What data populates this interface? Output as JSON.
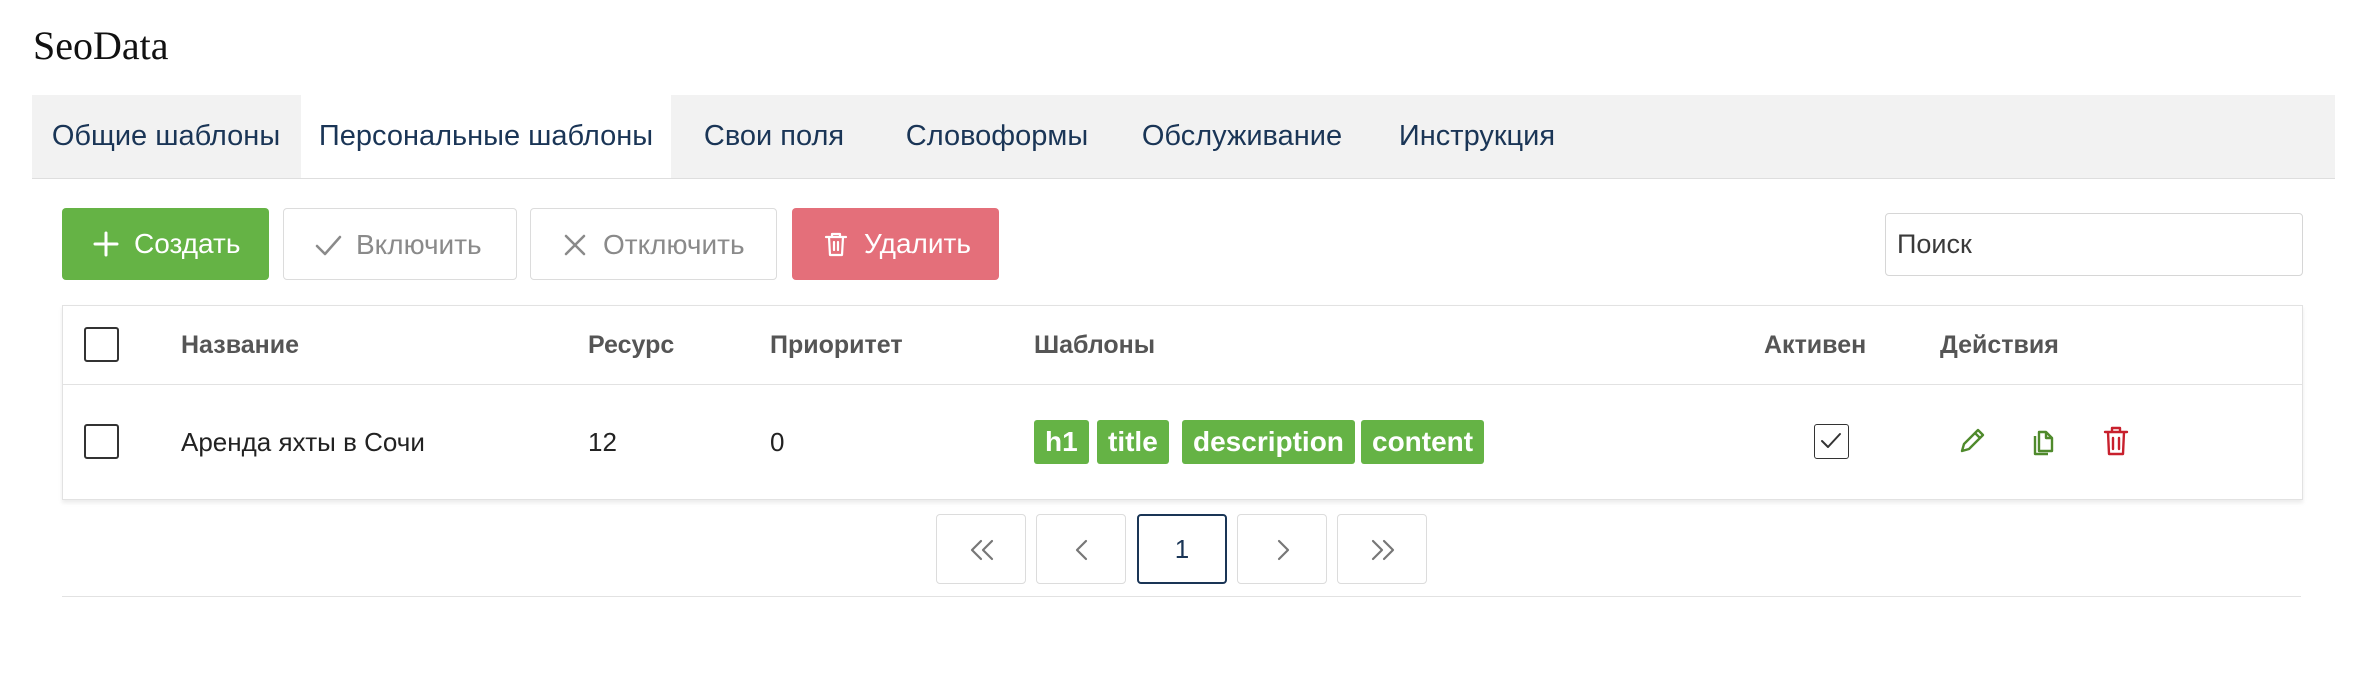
{
  "app": {
    "title": "SeoData"
  },
  "tabs": [
    {
      "label": "Общие шаблоны",
      "active": false
    },
    {
      "label": "Персональные шаблоны",
      "active": true
    },
    {
      "label": "Свои поля",
      "active": false
    },
    {
      "label": "Словоформы",
      "active": false
    },
    {
      "label": "Обслуживание",
      "active": false
    },
    {
      "label": "Инструкция",
      "active": false
    }
  ],
  "toolbar": {
    "create_label": "Создать",
    "enable_label": "Включить",
    "disable_label": "Отключить",
    "delete_label": "Удалить"
  },
  "search": {
    "placeholder": "Поиск",
    "value": ""
  },
  "table": {
    "columns": [
      "Название",
      "Ресурс",
      "Приоритет",
      "Шаблоны",
      "Активен",
      "Действия"
    ],
    "rows": [
      {
        "name": "Аренда яхты в Сочи",
        "resource": "12",
        "priority": "0",
        "templates": [
          "h1",
          "title",
          "description",
          "content"
        ],
        "active": true,
        "selected": false
      }
    ]
  },
  "pagination": {
    "current_page": "1",
    "icons": [
      "chevrons-left-icon",
      "chevron-left-icon",
      "chevron-right-icon",
      "chevrons-right-icon"
    ]
  },
  "colors": {
    "primary_green": "#65b345",
    "danger_red": "#e46f7a",
    "delete_icon_red": "#c8202d",
    "link_navy": "#1a3556",
    "tab_bar_bg": "#f2f2f2"
  }
}
